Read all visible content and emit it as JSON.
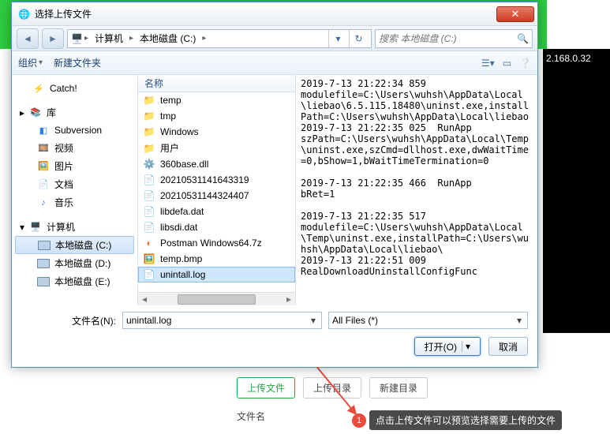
{
  "bg": {
    "ip": "2.168.0.32"
  },
  "bottom": {
    "upload_file": "上传文件",
    "upload_dir": "上传目录",
    "new_dir": "新建目录",
    "filename_label": "文件名"
  },
  "annotation": {
    "num": "1",
    "text": "点击上传文件可以预览选择需要上传的文件"
  },
  "dialog": {
    "title": "选择上传文件",
    "nav": {
      "back": "◄",
      "fwd": "►",
      "up": "▲"
    },
    "breadcrumb": {
      "computer": "计算机",
      "drive": "本地磁盘 (C:)"
    },
    "search_placeholder": "搜索 本地磁盘 (C:)",
    "toolbar": {
      "org": "组织",
      "newfolder": "新建文件夹"
    },
    "navpane": {
      "catch": "Catch!",
      "library": "库",
      "subversion": "Subversion",
      "video": "视频",
      "picture": "图片",
      "doc": "文档",
      "music": "音乐",
      "computer": "计算机",
      "drive_c": "本地磁盘 (C:)",
      "drive_d": "本地磁盘 (D:)",
      "drive_e": "本地磁盘 (E:)"
    },
    "columns": {
      "name": "名称"
    },
    "files": [
      {
        "name": "temp",
        "type": "folder"
      },
      {
        "name": "tmp",
        "type": "folder"
      },
      {
        "name": "Windows",
        "type": "folder"
      },
      {
        "name": "用户",
        "type": "folder"
      },
      {
        "name": "360base.dll",
        "type": "dll"
      },
      {
        "name": "20210531141643319",
        "type": "file"
      },
      {
        "name": "20210531144324407",
        "type": "file"
      },
      {
        "name": "libdefa.dat",
        "type": "file"
      },
      {
        "name": "libsdi.dat",
        "type": "file"
      },
      {
        "name": "Postman Windows64.7z",
        "type": "pm"
      },
      {
        "name": "temp.bmp",
        "type": "bmp"
      },
      {
        "name": "unintall.log",
        "type": "file",
        "selected": true
      }
    ],
    "preview": "2019-7-13 21:22:34 859\nmodulefile=C:\\Users\\wuhsh\\AppData\\Local\\liebao\\6.5.115.18480\\uninst.exe,installPath=C:\\Users\\wuhsh\\AppData\\Local\\liebao\n2019-7-13 21:22:35 025  RunApp\nszPath=C:\\Users\\wuhsh\\AppData\\Local\\Temp\\uninst.exe,szCmd=dllhost.exe,dwWaitTime=0,bShow=1,bWaitTimeTermination=0\n\n2019-7-13 21:22:35 466  RunApp\nbRet=1\n\n2019-7-13 21:22:35 517\nmodulefile=C:\\Users\\wuhsh\\AppData\\Local\\Temp\\uninst.exe,installPath=C:\\Users\\wuhsh\\AppData\\Local\\liebao\\\n2019-7-13 21:22:51 009\nRealDownloadUninstallConfigFunc",
    "filename_label": "文件名(N):",
    "filename_value": "unintall.log",
    "filter": "All Files (*)",
    "open": "打开(O)",
    "cancel": "取消"
  }
}
